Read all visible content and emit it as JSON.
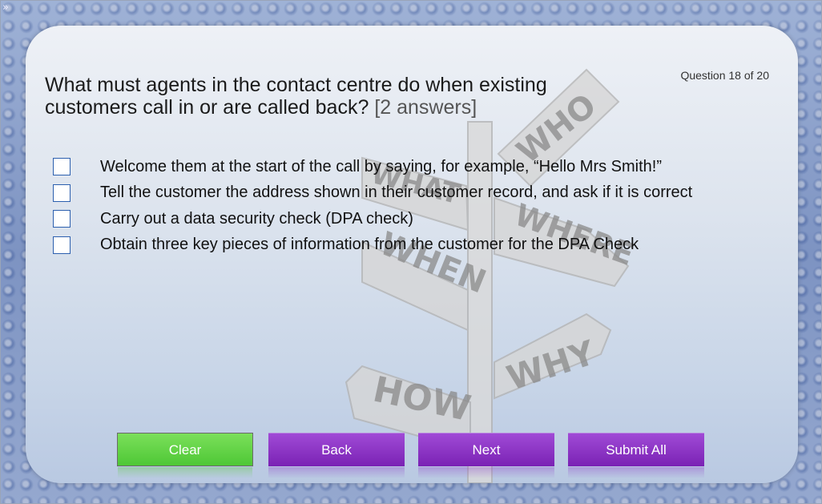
{
  "question": {
    "text": "What must agents in the contact centre do when existing customers call in or are called back?",
    "hint": "[2 answers]",
    "counter": "Question 18 of 20"
  },
  "options": [
    {
      "label": "Welcome them at the start of the call by saying, for example, “Hello Mrs Smith!”",
      "checked": false
    },
    {
      "label": "Tell the customer the address shown in their customer record, and ask if it is correct",
      "checked": false
    },
    {
      "label": "Carry out a data security check (DPA check)",
      "checked": false
    },
    {
      "label": "Obtain three key pieces of information from the customer for the DPA Check",
      "checked": false
    }
  ],
  "buttons": {
    "clear": "Clear",
    "back": "Back",
    "next": "Next",
    "submit": "Submit All"
  },
  "signpost": {
    "who": "WHO",
    "what": "WHAT",
    "where": "WHERE",
    "when": "WHEN",
    "why": "WHY",
    "how": "HOW"
  },
  "corner_glyph": "»",
  "colors": {
    "clear_button": "#5fd33f",
    "nav_button": "#8a30c4",
    "checkbox_border": "#2c5fae"
  }
}
